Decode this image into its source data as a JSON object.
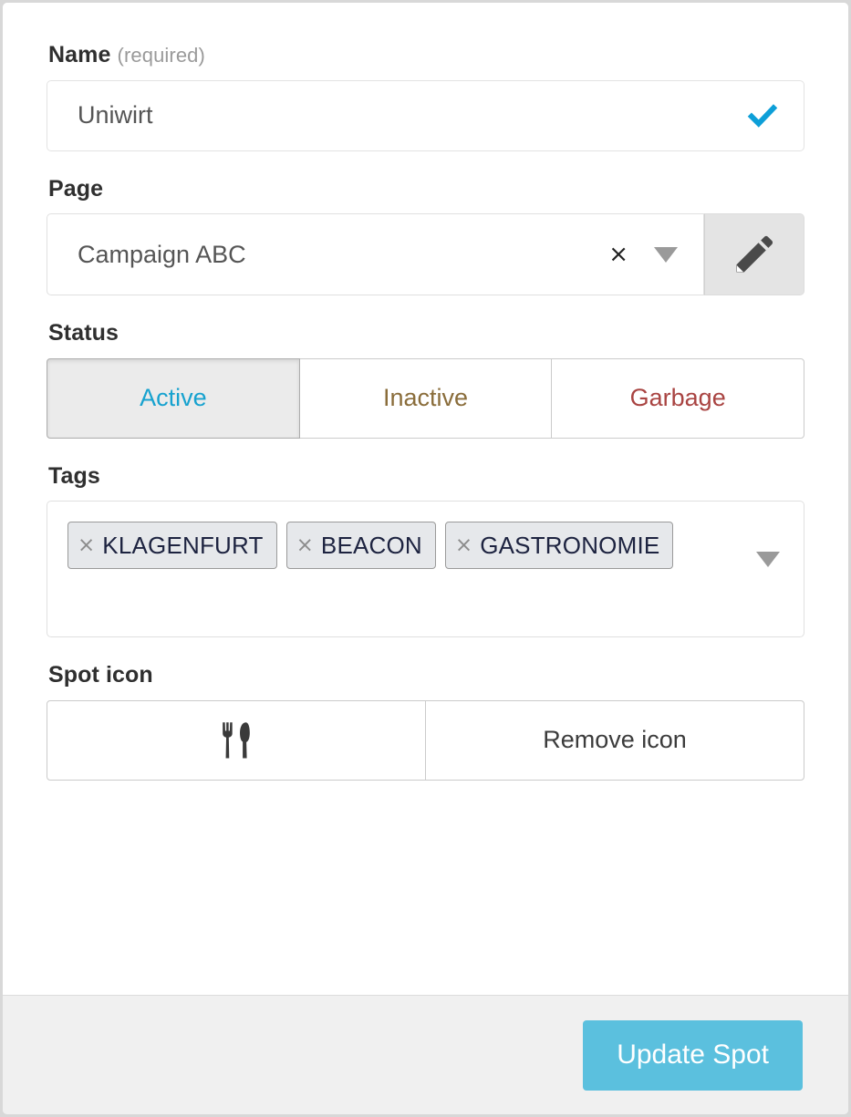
{
  "form": {
    "name": {
      "label": "Name",
      "optional_note": "(required)",
      "value": "Uniwirt",
      "placeholder": "",
      "valid_icon": "checkmark-icon",
      "valid_color": "#0d9fd8"
    },
    "page": {
      "label": "Page",
      "value": "Campaign ABC",
      "clear_glyph": "×",
      "caret_glyph": "▼",
      "edit_icon": "pencil-icon"
    },
    "status": {
      "label": "Status",
      "options": [
        {
          "label": "Active",
          "color": "#17a2cf",
          "selected": true
        },
        {
          "label": "Inactive",
          "color": "#8a6d3b",
          "selected": false
        },
        {
          "label": "Garbage",
          "color": "#a94442",
          "selected": false
        }
      ]
    },
    "tags": {
      "label": "Tags",
      "remove_glyph": "×",
      "caret_glyph": "▼",
      "items": [
        {
          "label": "KLAGENFURT"
        },
        {
          "label": "BEACON"
        },
        {
          "label": "GASTRONOMIE"
        }
      ]
    },
    "spot_icon": {
      "label": "Spot icon",
      "current_icon": "cutlery-icon",
      "remove_label": "Remove icon"
    }
  },
  "footer": {
    "submit_label": "Update Spot",
    "submit_color": "#5bc0de"
  }
}
